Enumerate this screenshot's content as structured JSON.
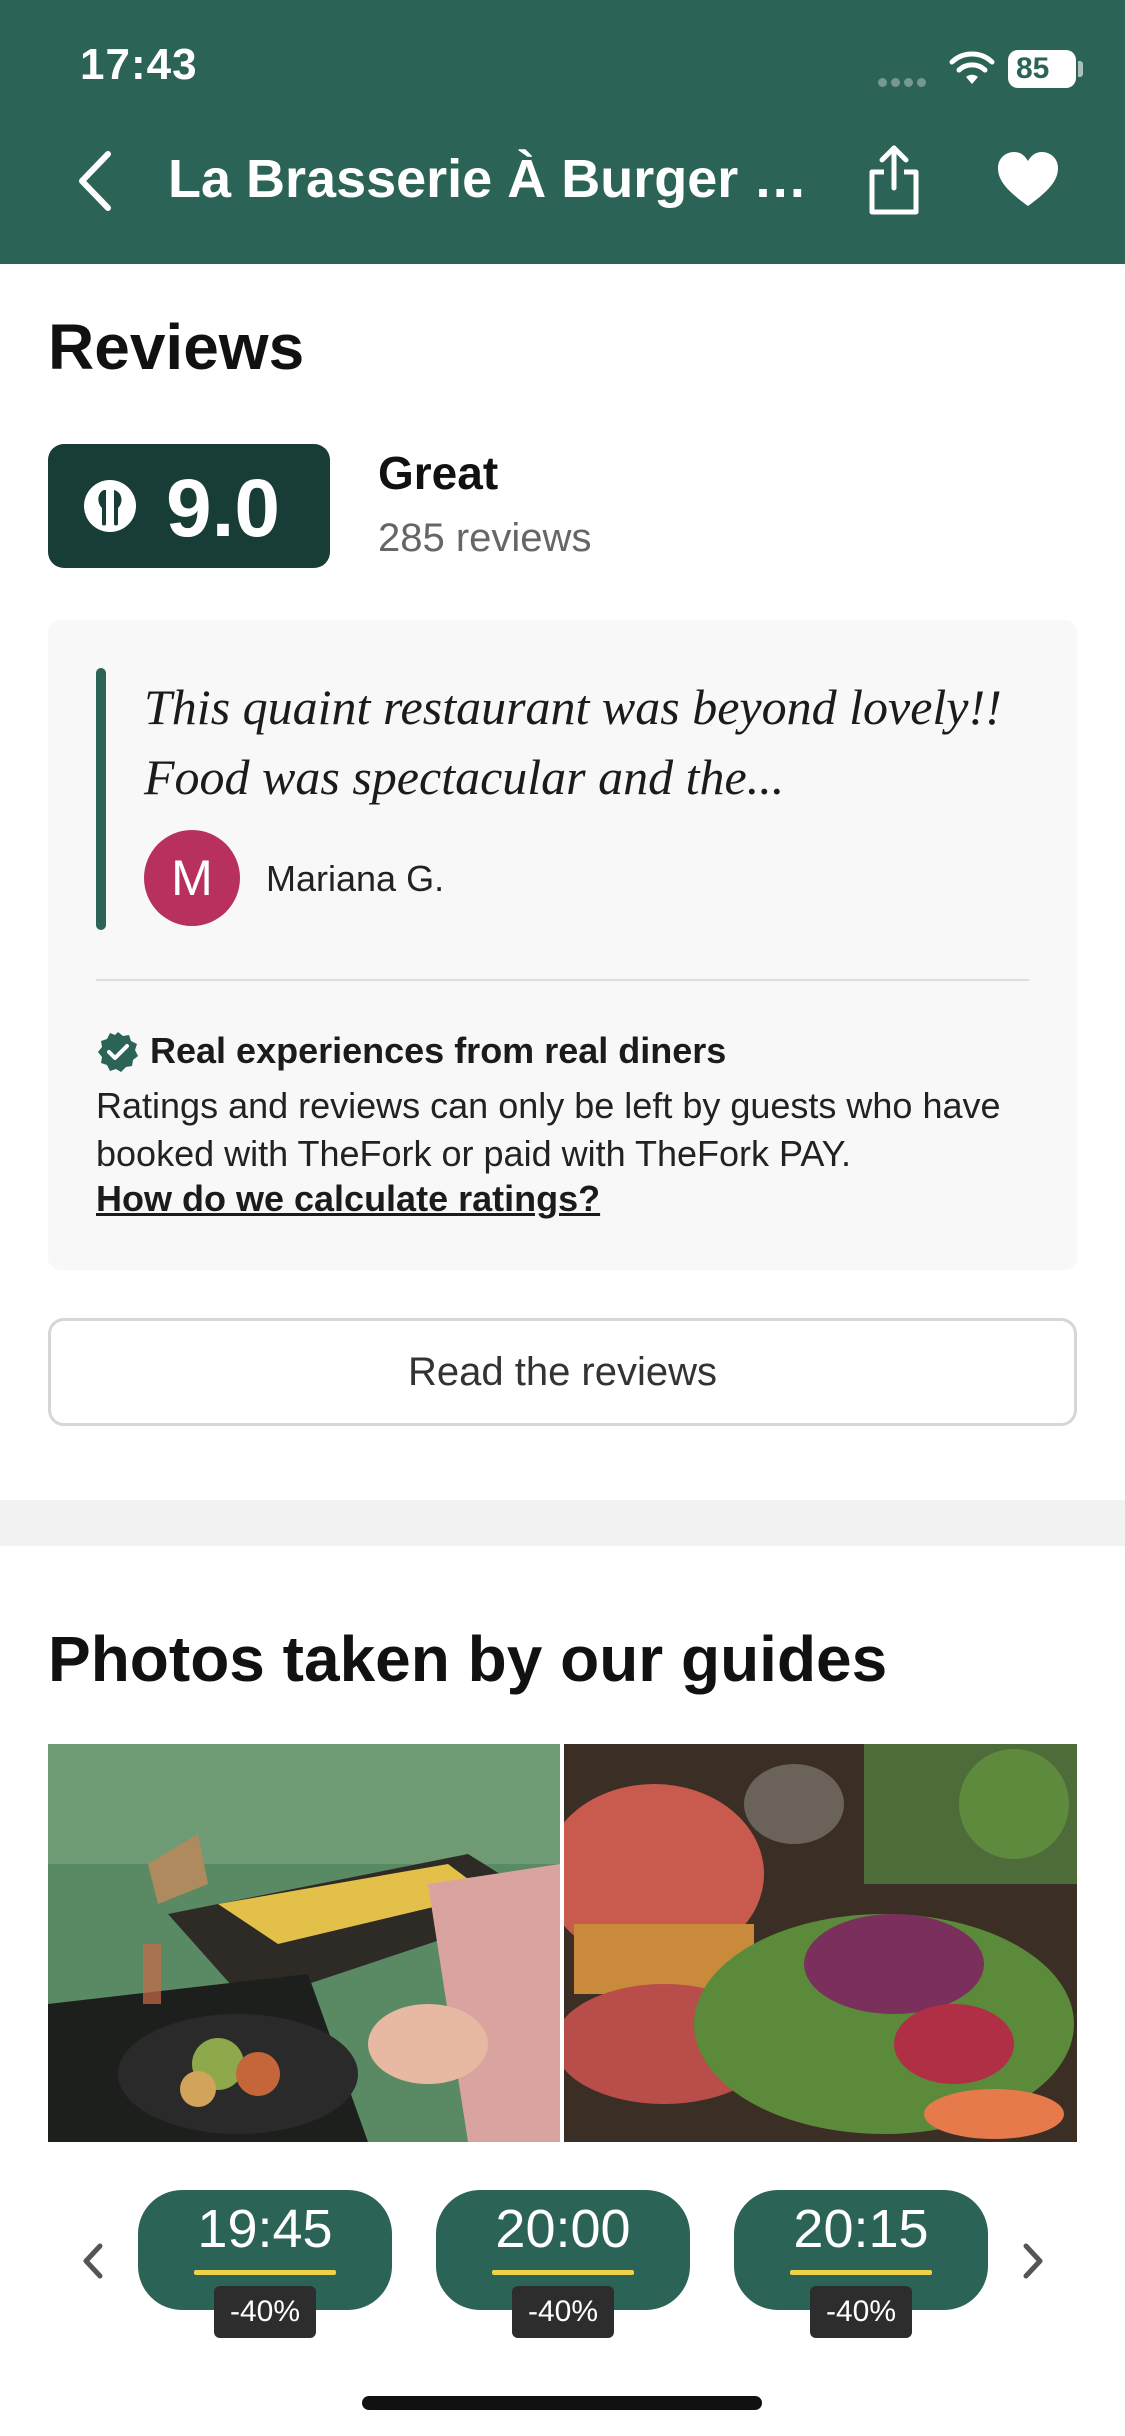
{
  "status_bar": {
    "time": "17:43",
    "battery": "85"
  },
  "header": {
    "title": "La Brasserie À Burger St..."
  },
  "icons": {
    "back": "chevron-left-icon",
    "share": "share-icon",
    "favorite": "heart-icon",
    "wifi": "wifi-icon",
    "verified": "verified-badge-icon",
    "fork": "fork-icon"
  },
  "reviews": {
    "heading": "Reviews",
    "score": "9.0",
    "label": "Great",
    "count": "285 reviews",
    "highlight": {
      "quote": "This quaint restaurant was beyond lovely!! Food was spectacular and the...",
      "avatar_initial": "M",
      "author": "Mariana G."
    },
    "trust": {
      "title": "Real experiences from real diners",
      "text": "Ratings and reviews can only be left by guests who have booked with TheFork or paid with TheFork PAY.",
      "link": "How do we calculate ratings?"
    },
    "read_button": "Read the reviews"
  },
  "photos": {
    "heading": "Photos taken by our guides"
  },
  "time_slots": [
    {
      "time": "19:45",
      "discount": "-40%"
    },
    {
      "time": "20:00",
      "discount": "-40%"
    },
    {
      "time": "20:15",
      "discount": "-40%"
    }
  ],
  "colors": {
    "brand_green": "#2b6356",
    "badge_dark": "#173d36",
    "avatar": "#b8305e",
    "accent_yellow": "#f0d24a"
  }
}
